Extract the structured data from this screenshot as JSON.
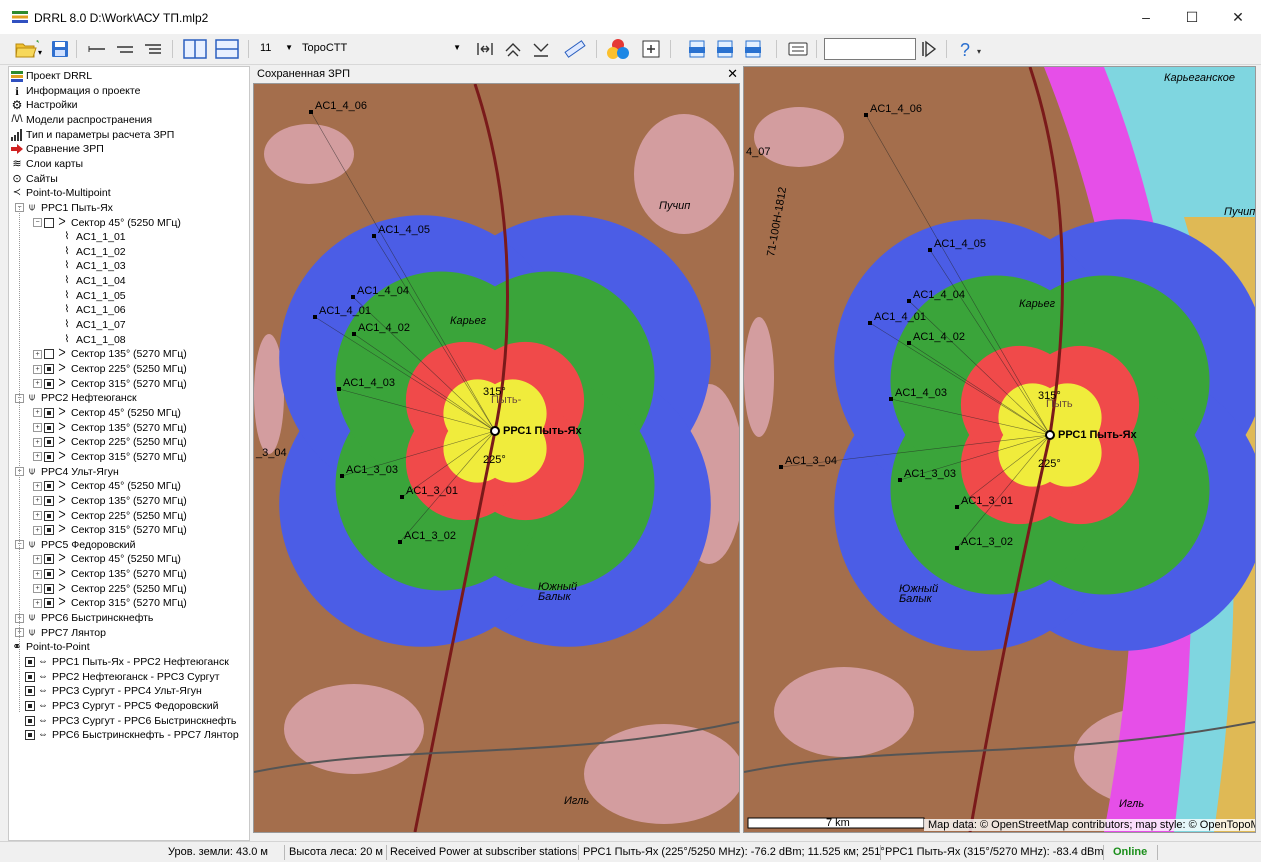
{
  "window": {
    "title": "DRRL 8.0 D:\\Work\\АСУ ТП.mlp2",
    "minimize": "–",
    "maximize": "☐",
    "close": "✕"
  },
  "toolbar": {
    "zoom_value": "11",
    "map_style_value": "TopoCTT",
    "search_value": ""
  },
  "tree": {
    "items": [
      {
        "label": "Проект DRRL",
        "icon": "project-icon"
      },
      {
        "label": "Информация о проекте",
        "icon": "info-icon"
      },
      {
        "label": "Настройки",
        "icon": "gear-icon"
      },
      {
        "label": "Модели распространения",
        "icon": "propagation-icon"
      },
      {
        "label": "Тип и параметры расчета ЗРП",
        "icon": "signal-bars-icon"
      },
      {
        "label": "Сравнение ЗРП",
        "icon": "compare-arrow-icon"
      },
      {
        "label": "Слои карты",
        "icon": "layers-icon"
      },
      {
        "label": "Сайты",
        "icon": "pin-icon"
      },
      {
        "label": "Point-to-Multipoint",
        "icon": "share-icon"
      },
      {
        "label": "РРС1 Пыть-Ях"
      },
      {
        "label": "Сектор 45° (5250 МГц)"
      },
      {
        "label": "AC1_1_01"
      },
      {
        "label": "AC1_1_02"
      },
      {
        "label": "AC1_1_03"
      },
      {
        "label": "AC1_1_04"
      },
      {
        "label": "AC1_1_05"
      },
      {
        "label": "AC1_1_06"
      },
      {
        "label": "AC1_1_07"
      },
      {
        "label": "AC1_1_08"
      },
      {
        "label": "Сектор 135° (5270 МГц)"
      },
      {
        "label": "Сектор 225° (5250 МГц)"
      },
      {
        "label": "Сектор 315° (5270 МГц)"
      },
      {
        "label": "РРС2 Нефтеюганск"
      },
      {
        "label": "Сектор 45° (5250 МГц)"
      },
      {
        "label": "Сектор 135° (5270 МГц)"
      },
      {
        "label": "Сектор 225° (5250 МГц)"
      },
      {
        "label": "Сектор 315° (5270 МГц)"
      },
      {
        "label": "РРС4 Ульт-Ягун"
      },
      {
        "label": "Сектор 45° (5250 МГц)"
      },
      {
        "label": "Сектор 135° (5270 МГц)"
      },
      {
        "label": "Сектор 225° (5250 МГц)"
      },
      {
        "label": "Сектор 315° (5270 МГц)"
      },
      {
        "label": "РРС5 Федоровский"
      },
      {
        "label": "Сектор 45° (5250 МГц)"
      },
      {
        "label": "Сектор 135° (5270 МГц)"
      },
      {
        "label": "Сектор 225° (5250 МГц)"
      },
      {
        "label": "Сектор 315° (5270 МГц)"
      },
      {
        "label": "РРС6 Быстринскнефть"
      },
      {
        "label": "РРС7 Лянтор"
      },
      {
        "label": "Point-to-Point"
      },
      {
        "label": "РРС1 Пыть-Ях - РРС2 Нефтеюганск"
      },
      {
        "label": "РРС2 Нефтеюганск - РРС3 Сургут"
      },
      {
        "label": "РРС3 Сургут - РРС4 Ульт-Ягун"
      },
      {
        "label": "РРС3 Сургут - РРС5 Федоровский"
      },
      {
        "label": "РРС3 Сургут - РРС6 Быстринскнефть"
      },
      {
        "label": "РРС6 Быстринскнефть - РРС7 Лянтор"
      }
    ]
  },
  "left_panel": {
    "title": "Сохраненная ЗРП",
    "close": "✕"
  },
  "maps": {
    "station_label": "РРС1 Пыть-Ях",
    "town_label": "Пыть-",
    "town_label_right": "Пыть",
    "angle_315": "315°",
    "angle_225": "225°",
    "subscriber_labels": [
      "AC1_4_06",
      "AC1_4_05",
      "AC1_4_04",
      "AC1_4_01",
      "AC1_4_02",
      "AC1_4_03",
      "AC1_3_03",
      "AC1_3_01",
      "AC1_3_02",
      "AC1_3_04"
    ],
    "cut_label_left": "_3_04",
    "cut_label_right": "4_07",
    "place_puchip": "Пучип",
    "place_karyeg": "Карьег",
    "place_karyeg_right": "Карьеганское",
    "place_yuzhny": "Южный",
    "place_balyk": "Балык",
    "place_igl": "Игль",
    "road_label": "71-100Н-1812",
    "scale_label": "7 km",
    "attribution": "Map data: © OpenStreetMap contributors; map style: © OpenTopoMap (CC-BY-SA)"
  },
  "statusbar": {
    "ground": "Уров. земли: 43.0 м",
    "forest": "Высота леса: 20 м",
    "mode": "Received Power at subscriber stations",
    "left_power": "РРС1 Пыть-Ях (225°/5250 MHz): -76.2 dBm; 11.525 км; 251°",
    "right_power": "РРС1 Пыть-Ях (315°/5270 MHz): -83.4 dBm",
    "online": "Online"
  },
  "colors": {
    "terrain_brown": "#a46e4c",
    "terrain_pink": "#d8a2a8",
    "coverage_blue": "#4b5de6",
    "coverage_green": "#3aa43a",
    "coverage_red": "#f04a4a",
    "coverage_yellow": "#f0ec3c",
    "coverage_magenta": "#e64fe8",
    "coverage_cyan": "#7fd6e0",
    "coverage_orange": "#f0b43c",
    "online_green": "#1b8f1b"
  }
}
